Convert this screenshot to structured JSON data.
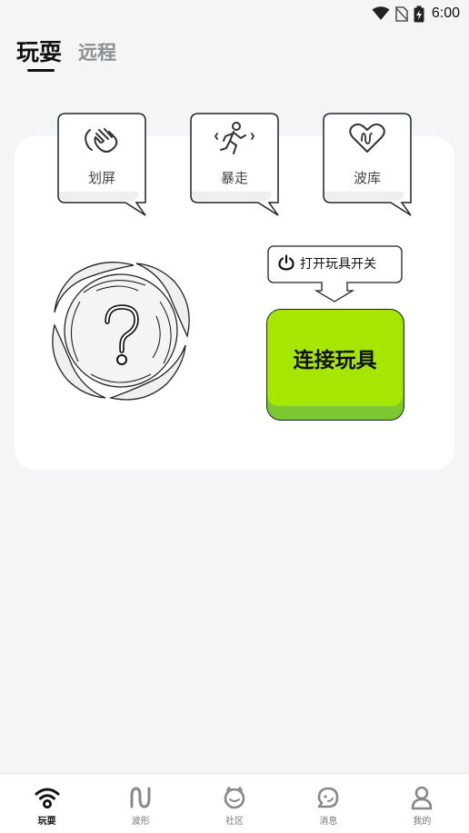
{
  "status_bar": {
    "time": "6:00",
    "icons": [
      "wifi-icon",
      "no-sim-icon",
      "battery-charging-icon"
    ]
  },
  "header": {
    "tabs": [
      {
        "label": "玩耍",
        "active": true
      },
      {
        "label": "远程",
        "active": false
      }
    ]
  },
  "features": [
    {
      "label": "划屏",
      "icon": "swipe-hand-icon"
    },
    {
      "label": "暴走",
      "icon": "running-person-icon"
    },
    {
      "label": "波库",
      "icon": "heart-wave-icon"
    }
  ],
  "toy_status": {
    "icon": "question-vortex-icon"
  },
  "power_hint": {
    "icon": "power-icon",
    "text": "打开玩具开关"
  },
  "connect_button": {
    "label": "连接玩具",
    "color": "#a6e600",
    "shadow_color": "#7bc830"
  },
  "bottom_nav": {
    "items": [
      {
        "label": "玩耍",
        "icon": "wifi-play-icon",
        "active": true
      },
      {
        "label": "波形",
        "icon": "wave-icon",
        "active": false
      },
      {
        "label": "社区",
        "icon": "community-icon",
        "active": false
      },
      {
        "label": "消息",
        "icon": "message-icon",
        "active": false
      },
      {
        "label": "我的",
        "icon": "profile-icon",
        "active": false
      }
    ]
  }
}
